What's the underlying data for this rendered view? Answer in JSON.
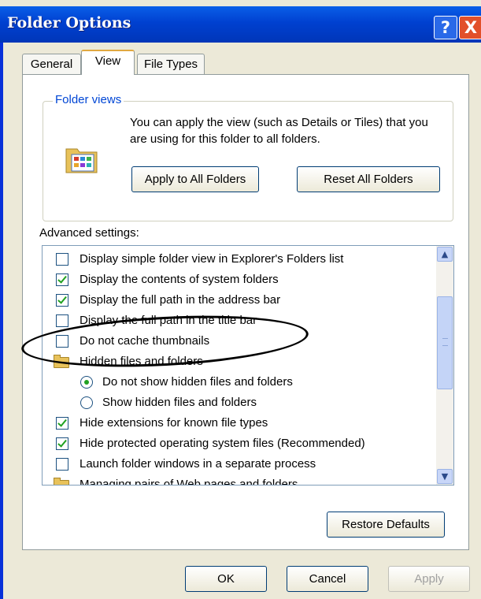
{
  "window": {
    "title": "Folder Options"
  },
  "titlebar_buttons": {
    "help": "?",
    "close": "X"
  },
  "tabs": [
    {
      "label": "General",
      "active": false
    },
    {
      "label": "View",
      "active": true
    },
    {
      "label": "File Types",
      "active": false
    }
  ],
  "folder_views": {
    "legend": "Folder views",
    "description": "You can apply the view (such as Details or Tiles) that you are using for this folder to all folders.",
    "apply_button": "Apply to All Folders",
    "reset_button": "Reset All Folders"
  },
  "advanced": {
    "label": "Advanced settings:",
    "items": [
      {
        "type": "checkbox",
        "checked": false,
        "label": "Display simple folder view in Explorer's Folders list"
      },
      {
        "type": "checkbox",
        "checked": true,
        "label": "Display the contents of system folders"
      },
      {
        "type": "checkbox",
        "checked": true,
        "label": "Display the full path in the address bar"
      },
      {
        "type": "checkbox",
        "checked": false,
        "label": "Display the full path in the title bar"
      },
      {
        "type": "checkbox",
        "checked": false,
        "label": "Do not cache thumbnails"
      },
      {
        "type": "folder",
        "label": "Hidden files and folders"
      },
      {
        "type": "radio",
        "checked": true,
        "label": "Do not show hidden files and folders"
      },
      {
        "type": "radio",
        "checked": false,
        "label": "Show hidden files and folders"
      },
      {
        "type": "checkbox",
        "checked": true,
        "label": "Hide extensions for known file types"
      },
      {
        "type": "checkbox",
        "checked": true,
        "label": "Hide protected operating system files (Recommended)"
      },
      {
        "type": "checkbox",
        "checked": false,
        "label": "Launch folder windows in a separate process"
      },
      {
        "type": "folder",
        "label": "Managing pairs of Web pages and folders"
      }
    ],
    "restore_button": "Restore Defaults"
  },
  "footer": {
    "ok": "OK",
    "cancel": "Cancel",
    "apply": "Apply"
  },
  "colors": {
    "titlebar": "#0a5fe8",
    "close": "#e2502a",
    "check": "#21a121",
    "legend": "#0046d5"
  }
}
